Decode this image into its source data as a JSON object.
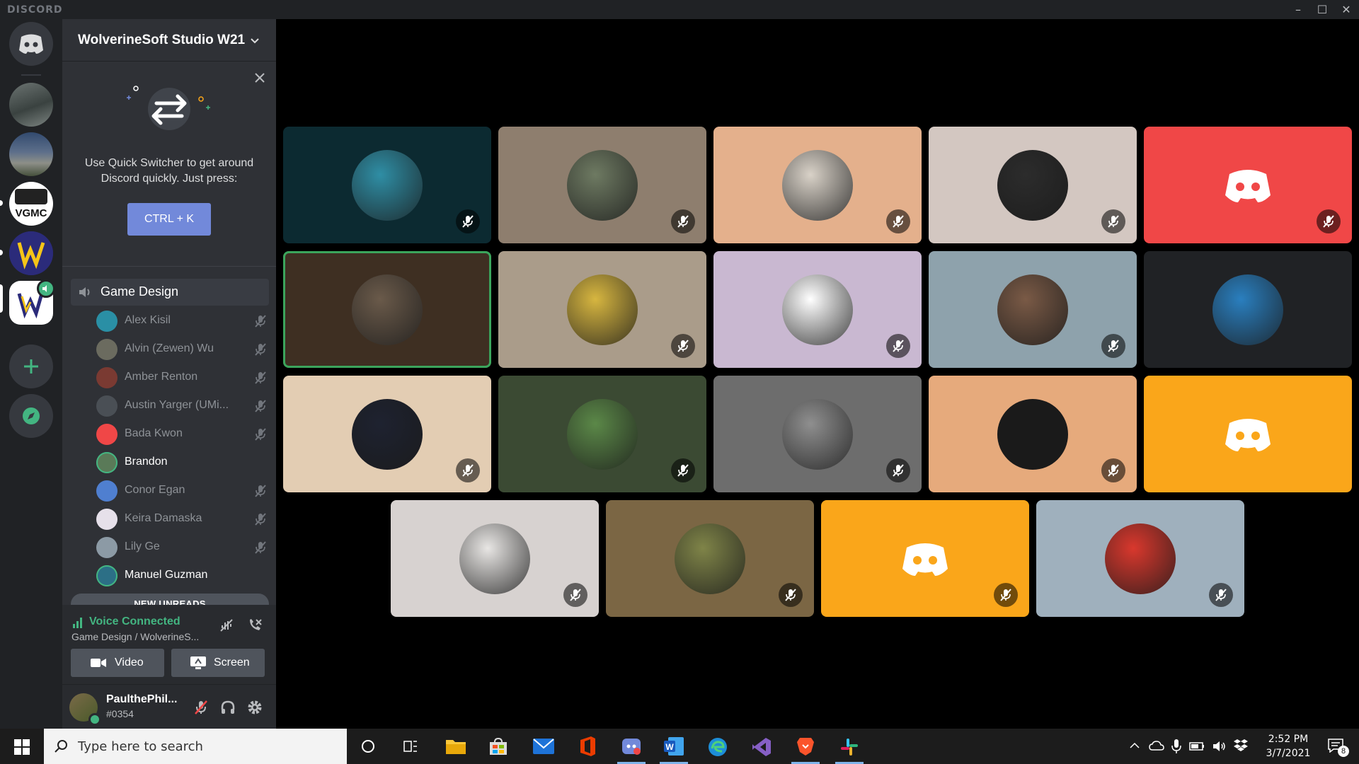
{
  "window": {
    "brand": "DISCORD"
  },
  "servers": [
    {
      "id": "home"
    },
    {
      "id": "server-2"
    },
    {
      "id": "server-3"
    },
    {
      "id": "vgmc",
      "label": "VGMC"
    },
    {
      "id": "server-5"
    },
    {
      "id": "wolverinesoft"
    }
  ],
  "guild": {
    "name": "WolverineSoft Studio W21"
  },
  "quick_switcher": {
    "text": "Use Quick Switcher to get around Discord quickly. Just press:",
    "button": "CTRL + K"
  },
  "voice_channel": {
    "name": "Game Design",
    "members": [
      {
        "name": "Alex Kisil",
        "active": false,
        "muted": true,
        "color": "#2a8fa5"
      },
      {
        "name": "Alvin (Zewen) Wu",
        "active": false,
        "muted": true,
        "color": "#6b6b5f"
      },
      {
        "name": "Amber Renton",
        "active": false,
        "muted": true,
        "color": "#7a3a32"
      },
      {
        "name": "Austin Yarger (UMi...",
        "active": false,
        "muted": true,
        "color": "#4a4f55"
      },
      {
        "name": "Bada Kwon",
        "active": false,
        "muted": true,
        "color": "#f04747"
      },
      {
        "name": "Brandon",
        "active": true,
        "muted": false,
        "color": "#5a7a58"
      },
      {
        "name": "Conor Egan",
        "active": false,
        "muted": true,
        "color": "#4f7fd0"
      },
      {
        "name": "Keira Damaska",
        "active": false,
        "muted": true,
        "color": "#e6e0ea"
      },
      {
        "name": "Lily Ge",
        "active": false,
        "muted": true,
        "color": "#8c9aa5"
      },
      {
        "name": "Manuel Guzman",
        "active": true,
        "muted": false,
        "color": "#2c6f86"
      }
    ],
    "new_unreads": "NEW UNREADS"
  },
  "voice": {
    "status": "Voice Connected",
    "sub": "Game Design / WolverineS...",
    "video_label": "Video",
    "screen_label": "Screen"
  },
  "user": {
    "name": "PaulthePhil...",
    "tag": "#0354"
  },
  "grid": [
    {
      "bg": "#0c2a31",
      "avatar": "#2f8ea5",
      "muted": true
    },
    {
      "bg": "#8e7e6e",
      "avatar": "#6e7a62",
      "muted": true
    },
    {
      "bg": "#e4b08c",
      "avatar": "#d9d2c8",
      "muted": true
    },
    {
      "bg": "#d3c7c1",
      "avatar": "#2c2c2c",
      "muted": true
    },
    {
      "bg": "#f04747",
      "avatar": "discord",
      "muted": true
    },
    {
      "bg": "#3e2f22",
      "avatar": "#6a5a4a",
      "muted": false,
      "speaking": true
    },
    {
      "bg": "#aa9c8a",
      "avatar": "#d7b640",
      "muted": true
    },
    {
      "bg": "#c9b8d1",
      "avatar": "#ffffff",
      "muted": true
    },
    {
      "bg": "#8ea2ac",
      "avatar": "#7a5a46",
      "muted": true
    },
    {
      "bg": "#202225",
      "avatar": "#2a7fbf",
      "muted": false
    },
    {
      "bg": "#e3cdb3",
      "avatar": "#1e2230",
      "muted": true
    },
    {
      "bg": "#3b4a33",
      "avatar": "#5b8848",
      "muted": true
    },
    {
      "bg": "#6d6d6d",
      "avatar": "#8f8f8f",
      "muted": true
    },
    {
      "bg": "#e6aa7c",
      "avatar": "#1a1a1a",
      "muted": true
    },
    {
      "bg": "#faa61a",
      "avatar": "discord",
      "muted": false
    },
    {
      "bg": "#d7d2d0",
      "avatar": "#e8e6e4",
      "muted": true
    },
    {
      "bg": "#7b6644",
      "avatar": "#7f8448",
      "muted": true
    },
    {
      "bg": "#faa61a",
      "avatar": "discord",
      "muted": true
    },
    {
      "bg": "#9fb0bd",
      "avatar": "#d9382d",
      "muted": true
    }
  ],
  "taskbar": {
    "search_placeholder": "Type here to search",
    "time": "2:52 PM",
    "date": "3/7/2021",
    "notification_count": "8"
  },
  "colors": {
    "blurple": "#7289da",
    "green": "#43b581",
    "speaking": "#3ba55c"
  }
}
